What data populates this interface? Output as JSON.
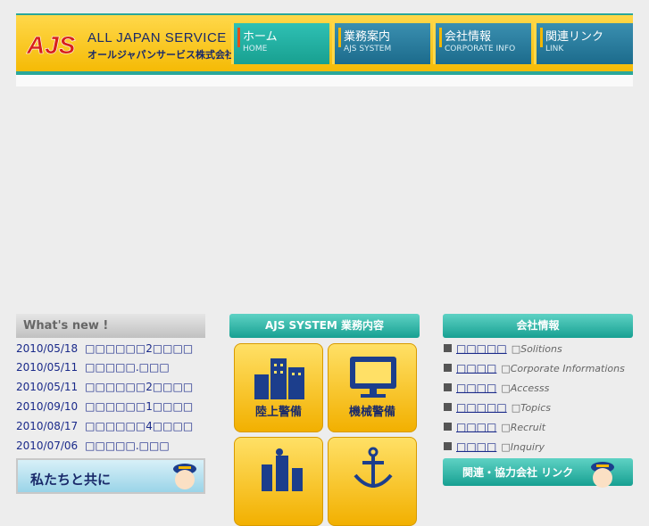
{
  "header": {
    "brand": "ALL JAPAN SERVICE",
    "brand_jp": "オールジャパンサービス株式会社",
    "nav": [
      {
        "jp": "ホーム",
        "en": "HOME"
      },
      {
        "jp": "業務案内",
        "en": "AJS SYSTEM"
      },
      {
        "jp": "会社情報",
        "en": "CORPORATE INFO"
      },
      {
        "jp": "関連リンク",
        "en": "LINK"
      }
    ]
  },
  "news": {
    "title": "What's new !",
    "items": [
      {
        "date": "2010/05/18",
        "text": "□□□□□□2□□□□"
      },
      {
        "date": "2010/05/11",
        "text": "□□□□□.□□□"
      },
      {
        "date": "2010/05/11",
        "text": "□□□□□□2□□□□"
      },
      {
        "date": "2010/09/10",
        "text": "□□□□□□1□□□□"
      },
      {
        "date": "2010/08/17",
        "text": "□□□□□□4□□□□"
      },
      {
        "date": "2010/07/06",
        "text": "□□□□□.□□□"
      }
    ],
    "banner": "私たちと共に"
  },
  "system": {
    "title": "AJS SYSTEM 業務内容",
    "tiles": [
      {
        "label": "陸上警備",
        "icon": "buildings-icon"
      },
      {
        "label": "機械警備",
        "icon": "monitor-icon"
      },
      {
        "label": "",
        "icon": "ship-icon"
      },
      {
        "label": "",
        "icon": "anchor-icon"
      }
    ]
  },
  "corporate": {
    "title": "会社情報",
    "items": [
      {
        "jp": "□□□□□",
        "en": "□Solitions"
      },
      {
        "jp": "□□□□",
        "en": "□Corporate Informations"
      },
      {
        "jp": "□□□□",
        "en": "□Accesss"
      },
      {
        "jp": "□□□□□",
        "en": "□Topics"
      },
      {
        "jp": "□□□□",
        "en": "□Recruit"
      },
      {
        "jp": "□□□□",
        "en": "□Inquiry"
      }
    ],
    "links_title": "関連・協力会社 リンク"
  },
  "colors": {
    "teal": "#17a092",
    "yellow": "#f4b800",
    "navy": "#1a2a6a"
  }
}
